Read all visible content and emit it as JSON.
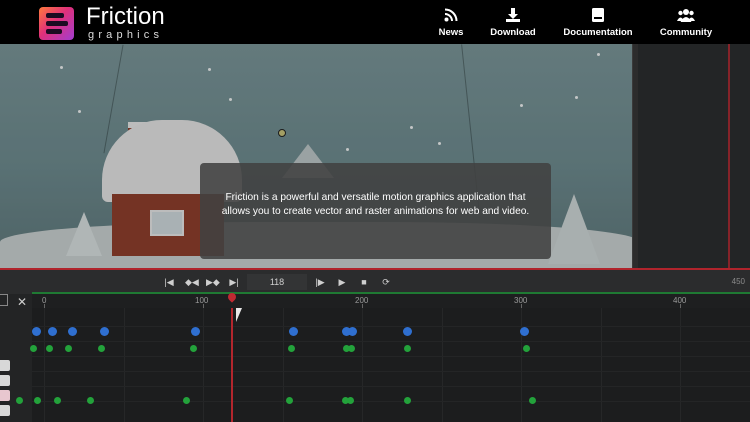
{
  "brand": {
    "name": "Friction",
    "sub": "graphics"
  },
  "nav": [
    {
      "label": "News",
      "icon": "rss-icon"
    },
    {
      "label": "Download",
      "icon": "download-icon"
    },
    {
      "label": "Documentation",
      "icon": "book-icon"
    },
    {
      "label": "Community",
      "icon": "users-icon"
    }
  ],
  "overlay": {
    "text": "Friction is a powerful and versatile motion graphics application that allows you to create vector and raster animations for web and video."
  },
  "timeline": {
    "current_frame": "118",
    "ruler_labels": [
      "0",
      "100",
      "200",
      "300",
      "400"
    ],
    "end_frame": "450"
  },
  "colors": {
    "accent_red": "#b0242c",
    "keyframe_blue": "#2f6fd0",
    "keyframe_green": "#23a23b",
    "brand_gradient_start": "#ff7a3c",
    "brand_gradient_end": "#a23dd0"
  }
}
